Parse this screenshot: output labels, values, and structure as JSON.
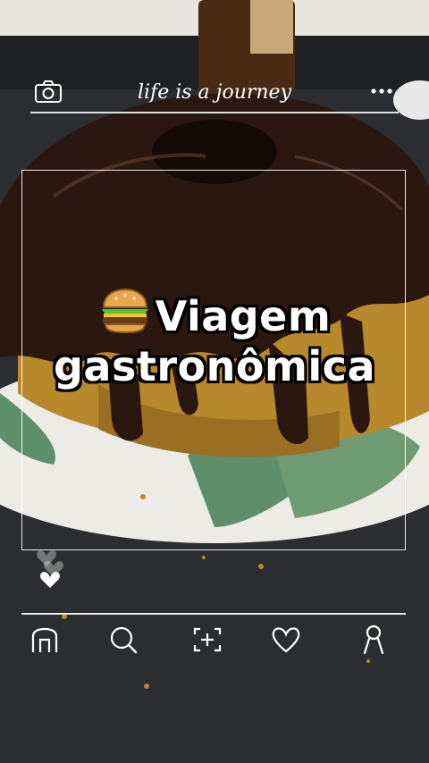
{
  "header": {
    "brand_text": "life is a journey",
    "camera_icon": "camera-icon",
    "more_icon": "more-dots-icon"
  },
  "post": {
    "title_line1": "Viagem",
    "title_line2": "gastronômica",
    "title_emoji_icon": "hamburger-emoji-icon"
  },
  "reactions": {
    "icons": [
      "heart-icon-faded",
      "heart-icon-faded",
      "heart-icon"
    ]
  },
  "nav": {
    "items": [
      {
        "name": "home",
        "icon": "home-icon"
      },
      {
        "name": "search",
        "icon": "search-icon"
      },
      {
        "name": "add",
        "icon": "add-post-icon"
      },
      {
        "name": "likes",
        "icon": "heart-outline-icon"
      },
      {
        "name": "profile",
        "icon": "profile-icon"
      }
    ]
  },
  "colors": {
    "overlay": "#ffffff",
    "background": "#2d2f33",
    "cake_glaze": "#2a1710",
    "cake_crumb": "#b88a2c",
    "plate": "#f0eeea",
    "leaf": "#5f8f6a"
  }
}
